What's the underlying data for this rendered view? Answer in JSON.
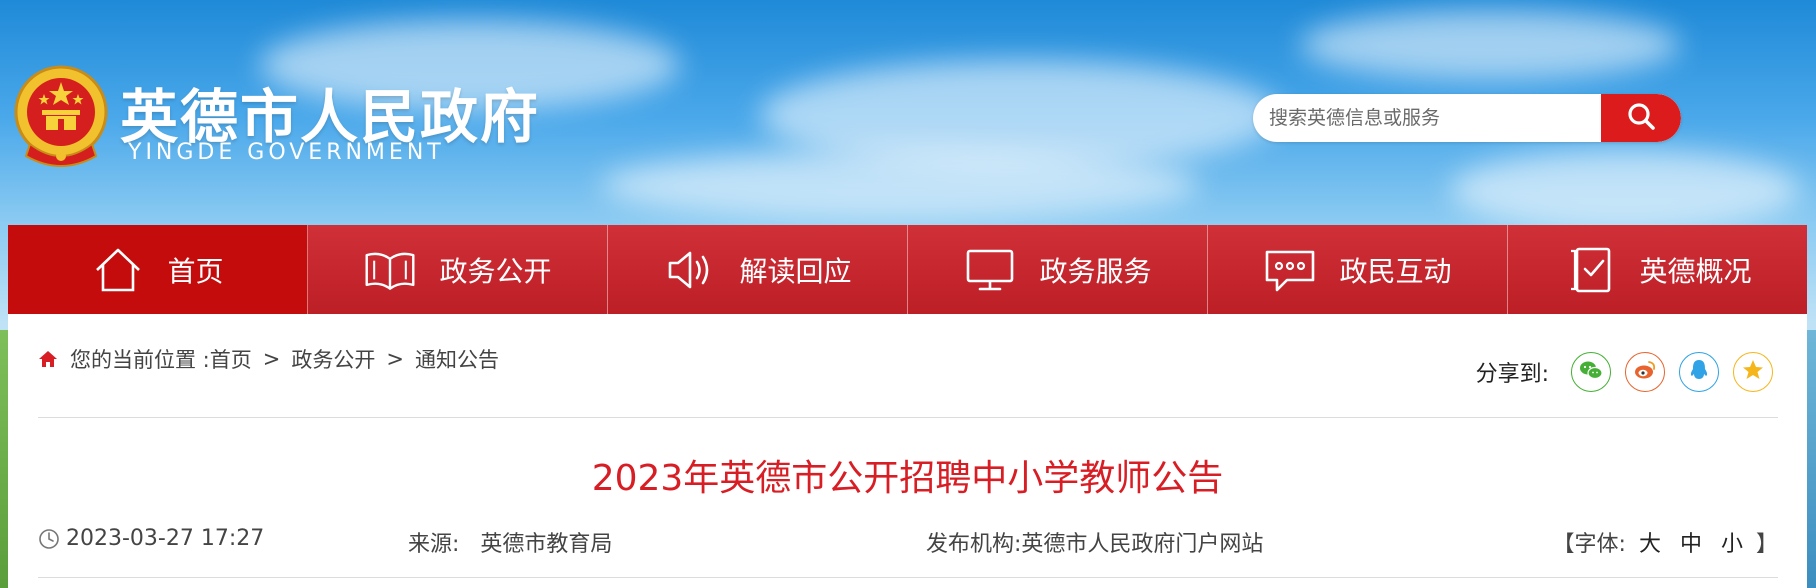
{
  "header": {
    "title": "英德市人民政府",
    "subtitle": "YINGDE GOVERNMENT",
    "search": {
      "placeholder": "搜索英德信息或服务"
    }
  },
  "nav": {
    "items": [
      {
        "label": "首页",
        "icon": "home-icon",
        "active": true
      },
      {
        "label": "政务公开",
        "icon": "book-icon",
        "active": false
      },
      {
        "label": "解读回应",
        "icon": "speaker-icon",
        "active": false
      },
      {
        "label": "政务服务",
        "icon": "monitor-icon",
        "active": false
      },
      {
        "label": "政民互动",
        "icon": "chat-icon",
        "active": false
      },
      {
        "label": "英德概况",
        "icon": "checklist-icon",
        "active": false
      }
    ]
  },
  "breadcrumb": {
    "prefix": "您的当前位置 : ",
    "items": [
      "首页",
      "政务公开",
      "通知公告"
    ],
    "separator": ">"
  },
  "share": {
    "label": "分享到:",
    "targets": [
      {
        "icon": "wechat-icon",
        "color": "#45b035"
      },
      {
        "icon": "weibo-icon",
        "color": "#e8632e"
      },
      {
        "icon": "qq-icon",
        "color": "#2fa3e6"
      },
      {
        "icon": "qzone-icon",
        "color": "#f5b61b"
      }
    ]
  },
  "article": {
    "title": "2023年英德市公开招聘中小学教师公告",
    "date": "2023-03-27 17:27",
    "source_label": "来源:",
    "source": "英德市教育局",
    "publisher_label": "发布机构:",
    "publisher": "英德市人民政府门户网站",
    "font_label": "【字体:",
    "font_sizes": [
      "大",
      "中",
      "小"
    ],
    "font_close": "】"
  },
  "colors": {
    "nav_red": "#c9262d",
    "active_red": "#c40c0c",
    "title_red": "#d81e25",
    "search_btn": "#dc1c1c"
  }
}
